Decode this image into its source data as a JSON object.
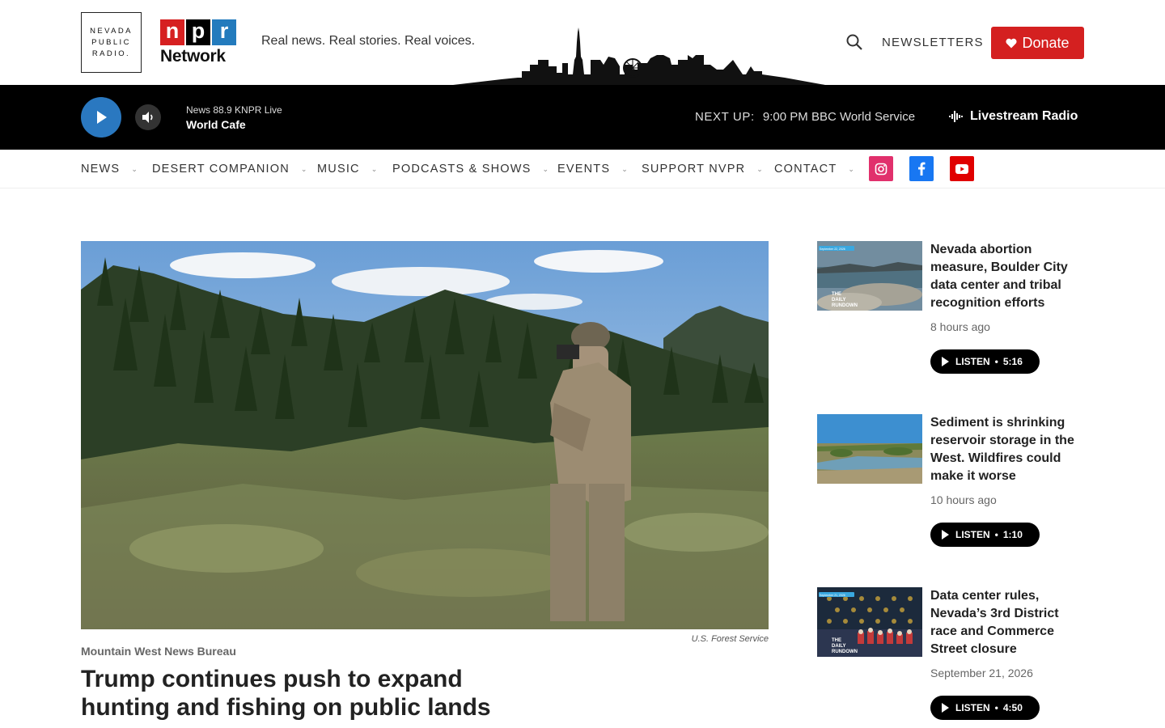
{
  "header": {
    "station_logo_lines": [
      "NEVADA",
      "PUBLIC",
      "RADIO."
    ],
    "npr_letters": [
      "n",
      "p",
      "r"
    ],
    "npr_network": "Network",
    "tagline": "Real news. Real stories. Real voices.",
    "newsletters": "NEWSLETTERS",
    "donate": "Donate",
    "icons": {
      "search": "search-icon",
      "heart": "heart-icon"
    },
    "colors": {
      "npr_n": "#d62021",
      "npr_p": "#000000",
      "npr_r": "#237bbd",
      "donate": "#d42020"
    }
  },
  "player": {
    "station": "News 88.9 KNPR Live",
    "program": "World Cafe",
    "next_up_label": "NEXT UP:",
    "next_up_time": "9:00 PM",
    "next_up_show": "BBC World Service",
    "livestream": "Livestream Radio",
    "colors": {
      "play_button": "#2a78c0"
    }
  },
  "nav": {
    "items": [
      {
        "label": "NEWS"
      },
      {
        "label": "DESERT COMPANION"
      },
      {
        "label": "MUSIC"
      },
      {
        "label": "PODCASTS & SHOWS"
      },
      {
        "label": "EVENTS"
      },
      {
        "label": "SUPPORT NVPR"
      },
      {
        "label": "CONTACT"
      }
    ],
    "social": [
      {
        "icon": "instagram-icon",
        "color": "#e1306c"
      },
      {
        "icon": "facebook-icon",
        "color": "#1877f2"
      },
      {
        "icon": "youtube-icon",
        "color": "#e00000"
      }
    ]
  },
  "main_story": {
    "image_credit": "U.S. Forest Service",
    "kicker": "Mountain West News Bureau",
    "headline": "Trump continues push to expand hunting and fishing on public lands"
  },
  "sidebar": {
    "listen_label": "LISTEN",
    "items": [
      {
        "title": "Nevada abortion measure, Boulder City data center and tribal recognition efforts",
        "time": "8 hours ago",
        "duration": "5:16",
        "thumb_date": "September 22, 2026",
        "thumb_text": [
          "THE",
          "DAILY",
          "RUNDOWN"
        ]
      },
      {
        "title": "Sediment is shrinking reservoir storage in the West. Wildfires could make it worse",
        "time": "10 hours ago",
        "duration": "1:10"
      },
      {
        "title": "Data center rules, Nevada’s 3rd District race and Commerce Street closure",
        "time": "September 21, 2026",
        "duration": "4:50",
        "thumb_date": "September 21, 2026",
        "thumb_text": [
          "THE",
          "DAILY",
          "RUNDOWN"
        ]
      }
    ]
  }
}
